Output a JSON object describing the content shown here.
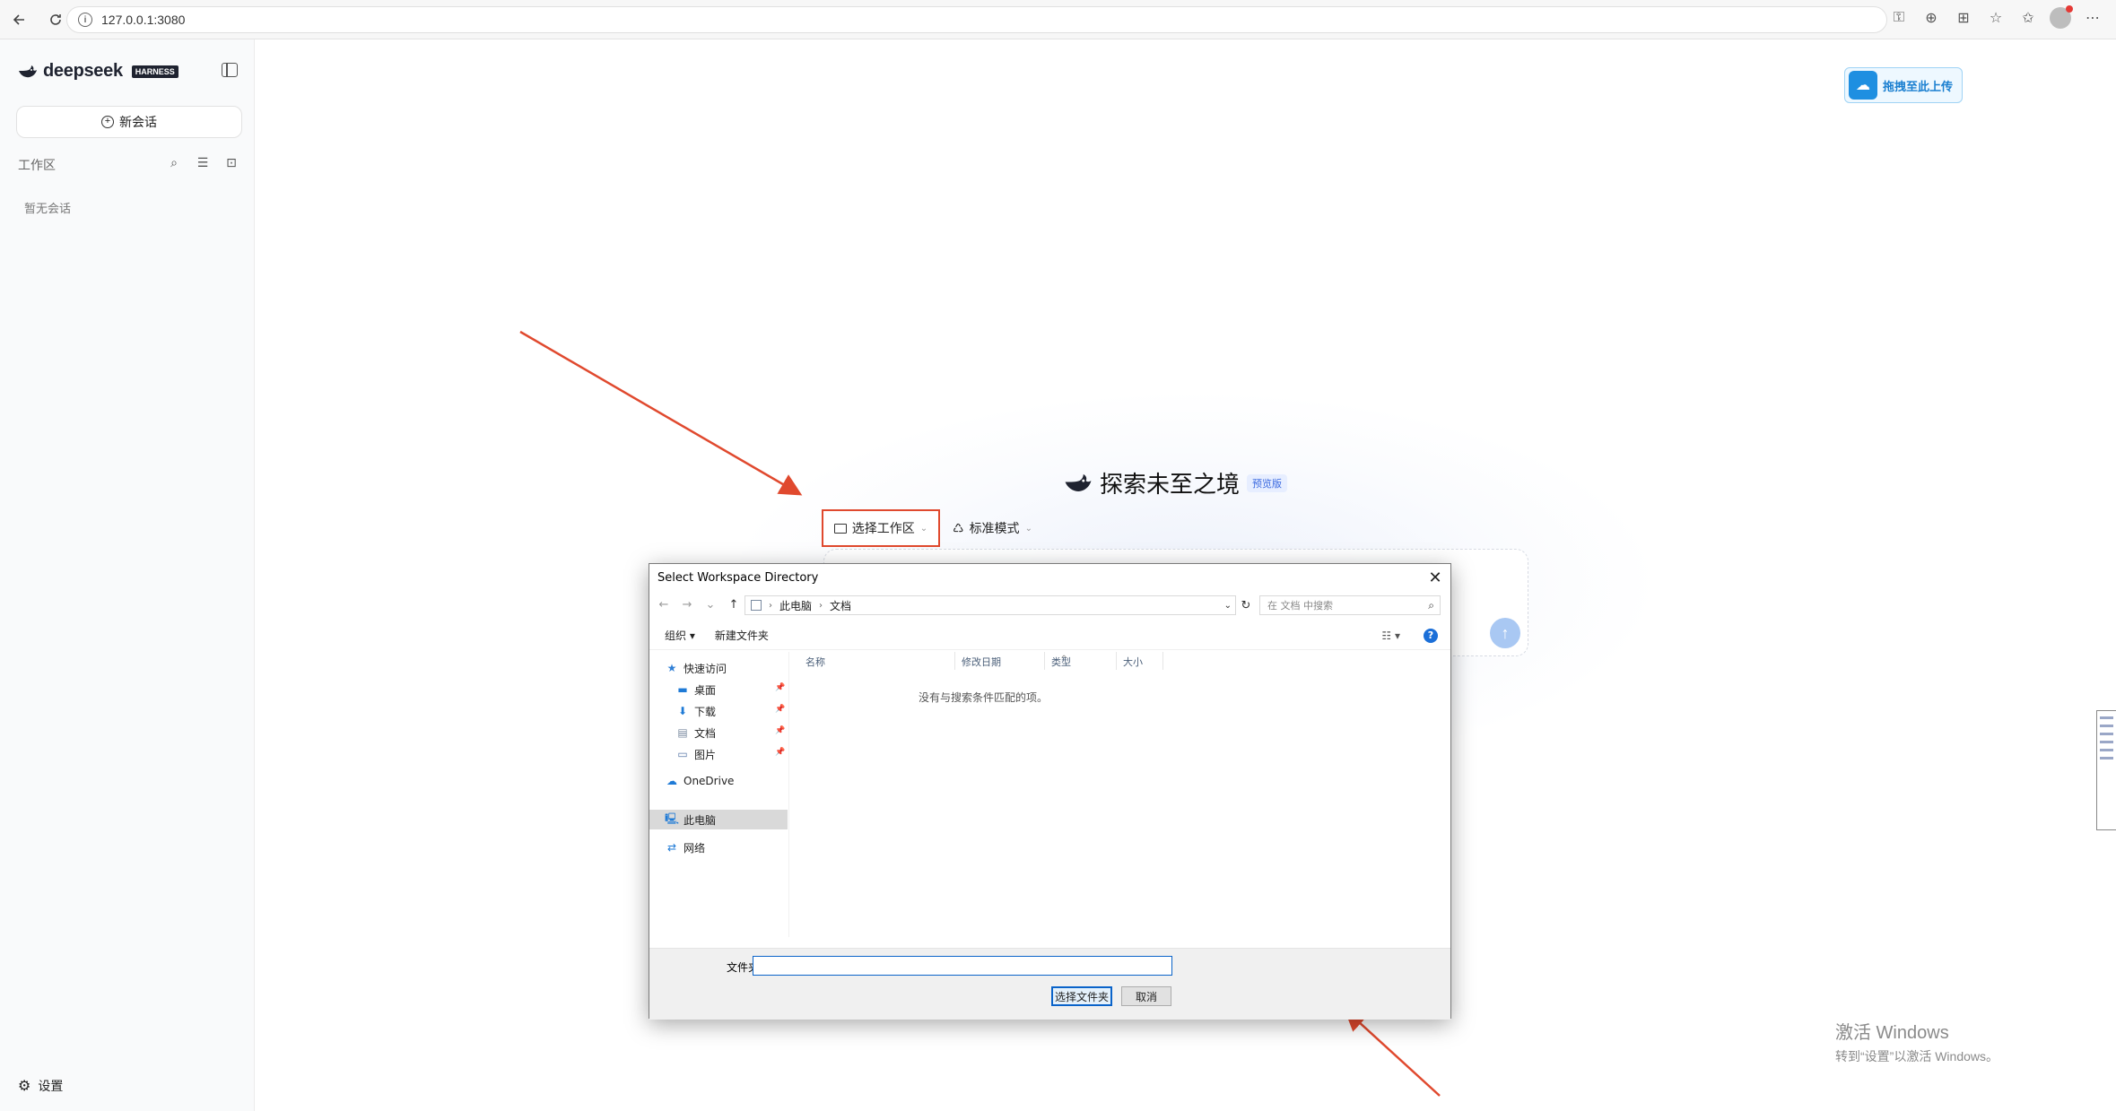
{
  "browser": {
    "url": "127.0.0.1:3080"
  },
  "sidebar": {
    "brand": "deepseek",
    "brand_badge": "HARNESS",
    "new_chat_label": "新会话",
    "workspace_label": "工作区",
    "empty_conversations": "暂无会话",
    "settings_label": "设置"
  },
  "main": {
    "upload_badge": "拖拽至此上传",
    "hero_title": "探索未至之境",
    "hero_tag": "预览版",
    "workspace_select_label": "选择工作区",
    "mode_label": "标准模式"
  },
  "dialog": {
    "title": "Select Workspace Directory",
    "breadcrumb": [
      "此电脑",
      "文档"
    ],
    "search_placeholder": "在 文档 中搜索",
    "toolbar": {
      "organize": "组织 ▾",
      "new_folder": "新建文件夹"
    },
    "tree": {
      "quick_access": "快速访问",
      "desktop": "桌面",
      "downloads": "下载",
      "documents": "文档",
      "pictures": "图片",
      "onedrive": "OneDrive",
      "this_pc": "此电脑",
      "network": "网络"
    },
    "columns": {
      "name": "名称",
      "modified": "修改日期",
      "type": "类型",
      "size": "大小"
    },
    "empty_message": "没有与搜索条件匹配的项。",
    "folder_label": "文件夹:",
    "folder_value": "",
    "ok_label": "选择文件夹",
    "cancel_label": "取消"
  },
  "watermark": {
    "line1": "激活 Windows",
    "line2": "转到“设置”以激活 Windows。"
  },
  "colors": {
    "annotation_red": "#e0492e",
    "accent_blue": "#1e8fe1",
    "dialog_selection": "#0a63c9"
  }
}
